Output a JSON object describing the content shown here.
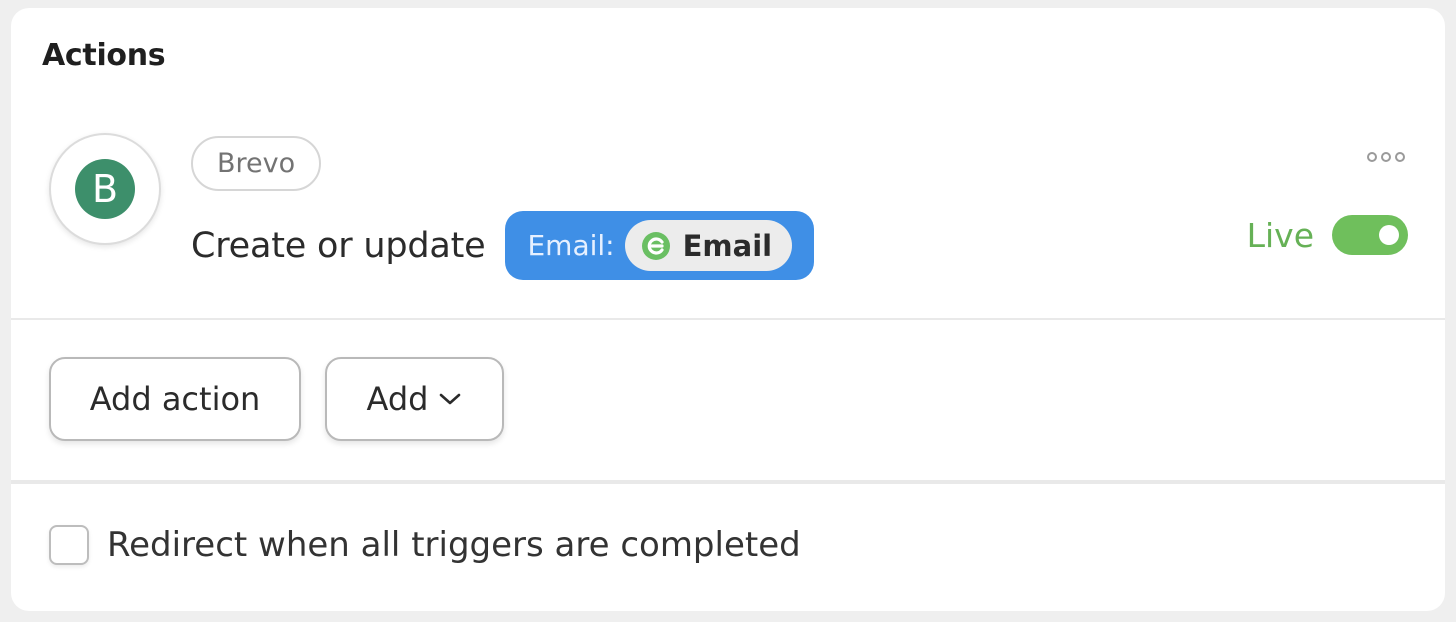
{
  "section": {
    "title": "Actions"
  },
  "action": {
    "app_icon": "brevo-logo-icon",
    "app_icon_letter": "B",
    "app_name": "Brevo",
    "label": "Create or update",
    "field": {
      "key": "Email:",
      "value_icon": "email-field-icon",
      "value": "Email"
    },
    "more_icon": "more-horizontal-icon",
    "status": {
      "label": "Live",
      "enabled": true
    }
  },
  "buttons": {
    "add_action": "Add action",
    "add": "Add",
    "add_icon": "chevron-down-icon"
  },
  "redirect": {
    "checked": false,
    "label": "Redirect when all triggers are completed"
  },
  "colors": {
    "brand_green": "#3d8f6b",
    "pill_blue": "#3f8fe6",
    "live_green": "#66b156"
  }
}
